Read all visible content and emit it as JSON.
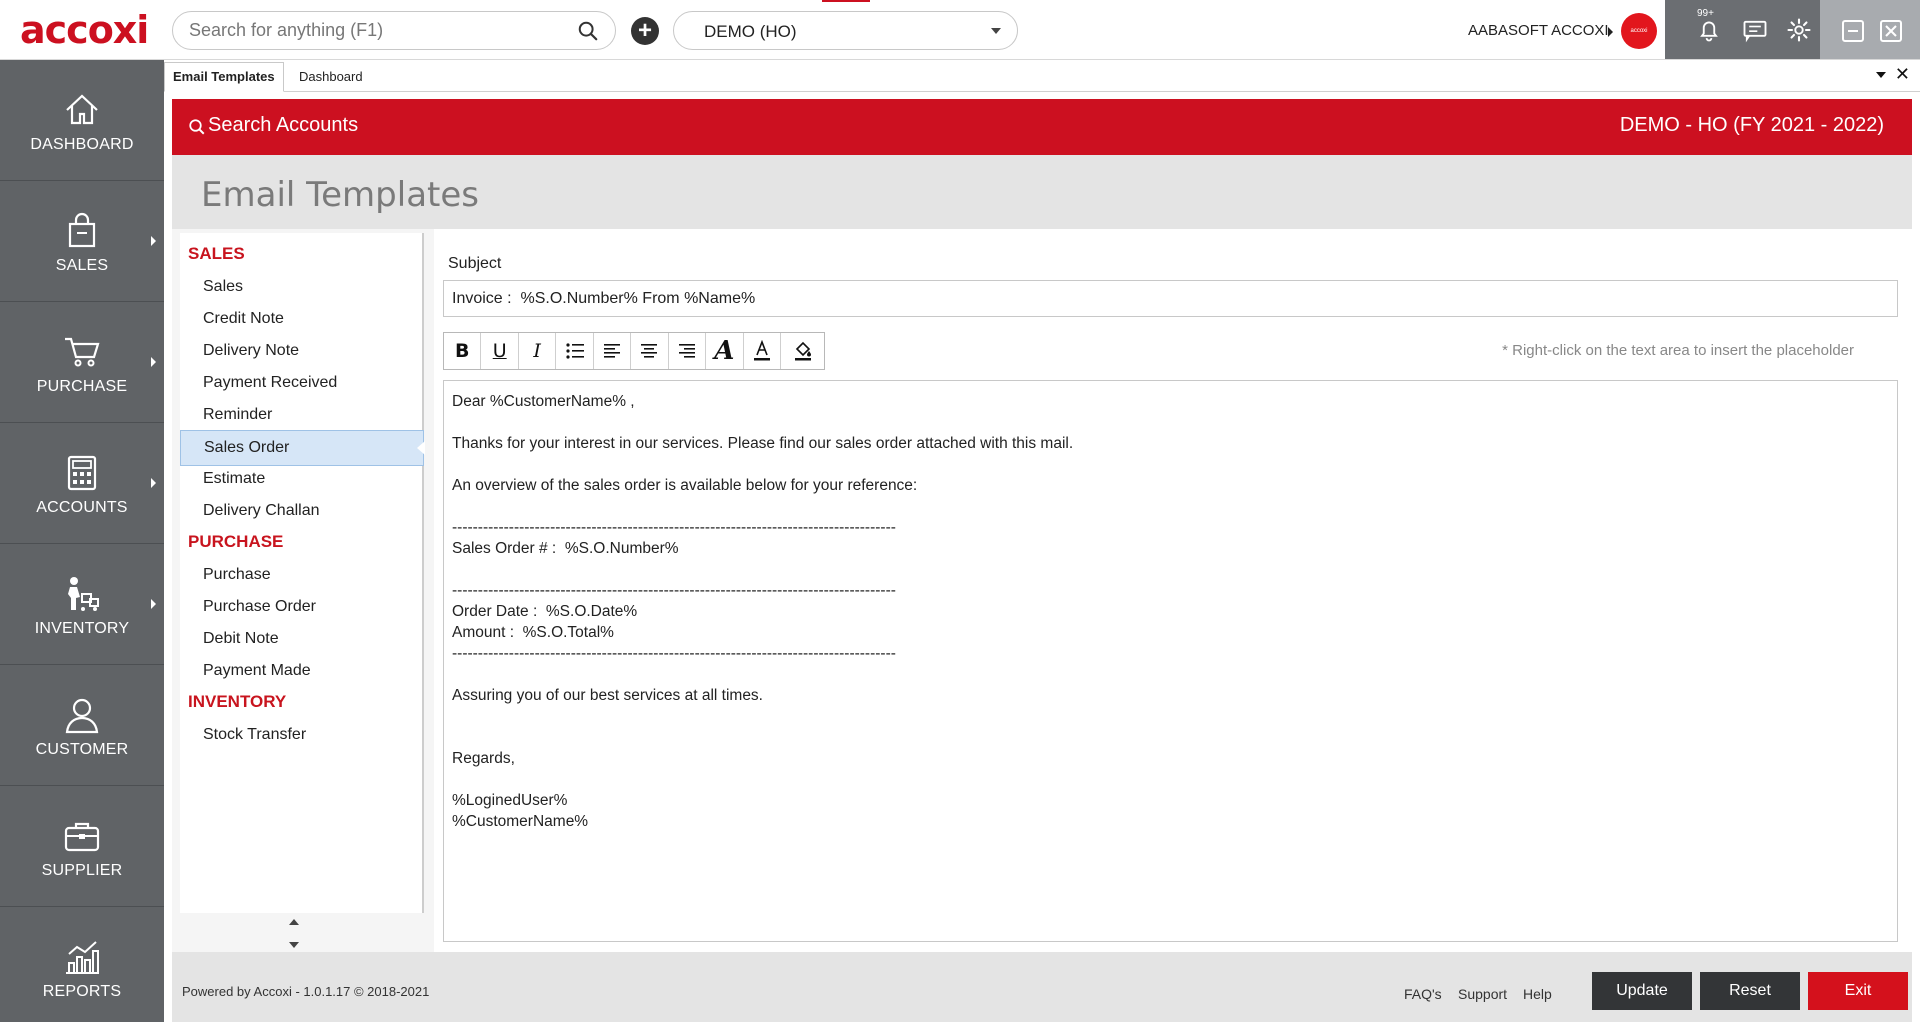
{
  "app": {
    "logo": "accoxi",
    "search_placeholder": "Search for anything (F1)",
    "company_select": "DEMO (HO)",
    "user_name": "AABASOFT ACCOXI",
    "avatar_text": "accoxi",
    "notifications_badge": "99+"
  },
  "nav": [
    {
      "label": "DASHBOARD",
      "icon": "home-icon"
    },
    {
      "label": "SALES",
      "icon": "shopping-bag-icon"
    },
    {
      "label": "PURCHASE",
      "icon": "cart-icon"
    },
    {
      "label": "ACCOUNTS",
      "icon": "calculator-icon"
    },
    {
      "label": "INVENTORY",
      "icon": "inventory-icon"
    },
    {
      "label": "CUSTOMER",
      "icon": "customer-icon"
    },
    {
      "label": "SUPPLIER",
      "icon": "briefcase-icon"
    },
    {
      "label": "REPORTS",
      "icon": "reports-icon"
    }
  ],
  "tabs": [
    "Email Templates",
    "Dashboard"
  ],
  "header": {
    "search_accounts": "Search Accounts",
    "company": "DEMO - HO (FY 2021 - 2022)"
  },
  "page_title": "Email Templates",
  "templates": {
    "groups": [
      {
        "title": "SALES",
        "items": [
          "Sales",
          "Credit Note",
          "Delivery Note",
          "Payment Received",
          "Reminder",
          "Sales Order",
          "Estimate",
          "Delivery Challan"
        ]
      },
      {
        "title": "PURCHASE",
        "items": [
          "Purchase",
          "Purchase Order",
          "Debit Note",
          "Payment Made"
        ]
      },
      {
        "title": "INVENTORY",
        "items": [
          "Stock Transfer"
        ]
      }
    ],
    "selected": "Sales Order"
  },
  "editor": {
    "subject_label": "Subject",
    "subject_value": "Invoice :  %S.O.Number% From %Name%",
    "hint": "* Right-click on the text area to insert the placeholder",
    "toolbar": [
      "bold",
      "underline",
      "italic",
      "list",
      "align-left",
      "align-center",
      "align-right",
      "font",
      "font-color",
      "fill-color"
    ],
    "body_lines": [
      "Dear %CustomerName% ,",
      "",
      "Thanks for your interest in our services. Please find our sales order attached with this mail.",
      "",
      "An overview of the sales order is available below for your reference:",
      "",
      "--------------------------------------------------------------------------------------",
      "Sales Order # :  %S.O.Number%",
      "",
      "--------------------------------------------------------------------------------------",
      "Order Date :  %S.O.Date%",
      "Amount :  %S.O.Total%",
      "--------------------------------------------------------------------------------------",
      "",
      "Assuring you of our best services at all times.",
      "",
      "",
      "Regards,",
      "",
      "%LoginedUser%",
      "%CustomerName%"
    ]
  },
  "footer": {
    "powered": "Powered by Accoxi - 1.0.1.17 © 2018-2021",
    "links": [
      "FAQ's",
      "Support",
      "Help"
    ],
    "update": "Update",
    "reset": "Reset",
    "exit": "Exit"
  },
  "colors": {
    "brand_red": "#cc1020",
    "nav_bg": "#606366",
    "selected_row": "#d6e6f7"
  }
}
